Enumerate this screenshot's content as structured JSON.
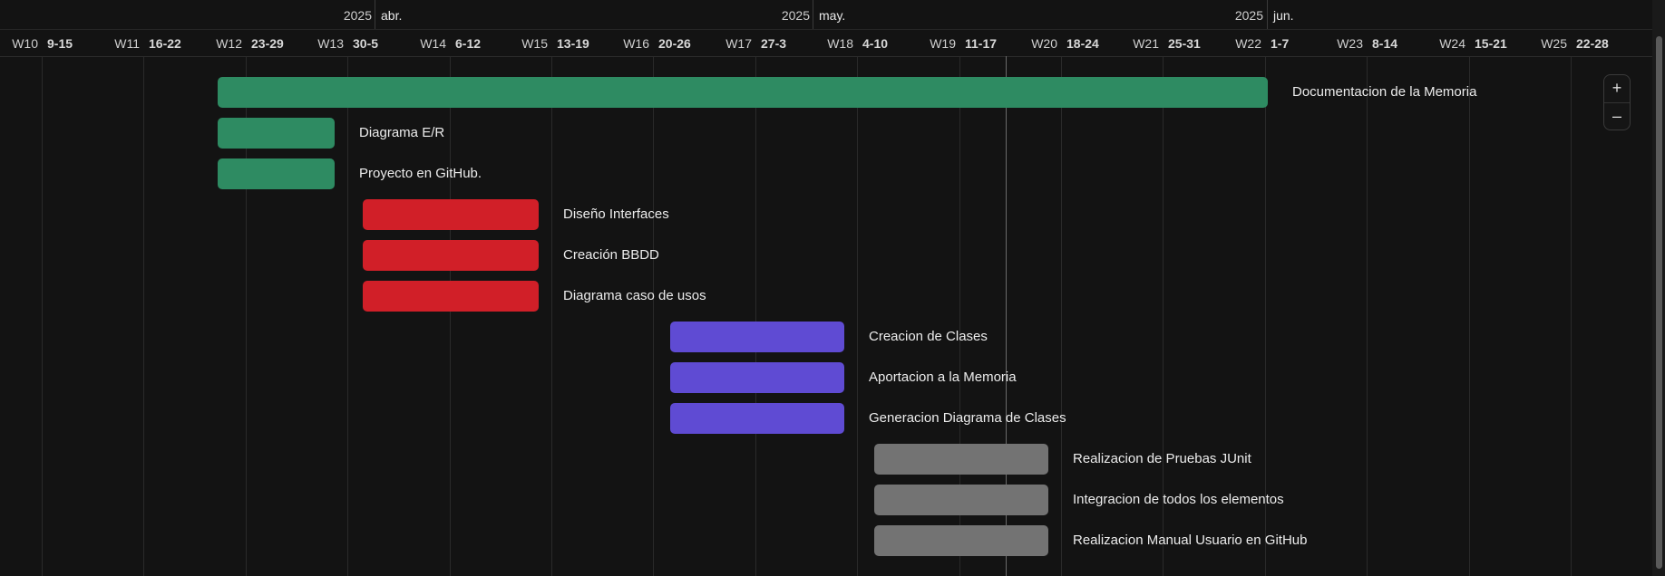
{
  "colors": {
    "background": "#131313",
    "green": "#2e8b62",
    "red": "#d11f28",
    "purple": "#5f4bd3",
    "gray": "#737373"
  },
  "timeline": {
    "months": [
      {
        "year": "2025",
        "label": "abr."
      },
      {
        "year": "2025",
        "label": "may."
      },
      {
        "year": "2025",
        "label": "jun."
      }
    ],
    "weeks": [
      {
        "num": "W10",
        "range": "9-15"
      },
      {
        "num": "W11",
        "range": "16-22"
      },
      {
        "num": "W12",
        "range": "23-29"
      },
      {
        "num": "W13",
        "range": "30-5"
      },
      {
        "num": "W14",
        "range": "6-12"
      },
      {
        "num": "W15",
        "range": "13-19"
      },
      {
        "num": "W16",
        "range": "20-26"
      },
      {
        "num": "W17",
        "range": "27-3"
      },
      {
        "num": "W18",
        "range": "4-10"
      },
      {
        "num": "W19",
        "range": "11-17"
      },
      {
        "num": "W20",
        "range": "18-24"
      },
      {
        "num": "W21",
        "range": "25-31"
      },
      {
        "num": "W22",
        "range": "1-7"
      },
      {
        "num": "W23",
        "range": "8-14"
      },
      {
        "num": "W24",
        "range": "15-21"
      },
      {
        "num": "W25",
        "range": "22-28"
      }
    ]
  },
  "tasks": [
    {
      "name": "Documentacion de la Memoria",
      "color": "green"
    },
    {
      "name": "Diagrama E/R",
      "color": "green"
    },
    {
      "name": "Proyecto en GitHub.",
      "color": "green"
    },
    {
      "name": "Diseño Interfaces",
      "color": "red"
    },
    {
      "name": "Creación BBDD",
      "color": "red"
    },
    {
      "name": "Diagrama caso de usos",
      "color": "red"
    },
    {
      "name": "Creacion de Clases",
      "color": "purple"
    },
    {
      "name": "Aportacion a la Memoria",
      "color": "purple"
    },
    {
      "name": "Generacion Diagrama de Clases",
      "color": "purple"
    },
    {
      "name": "Realizacion de Pruebas JUnit",
      "color": "gray"
    },
    {
      "name": "Integracion de todos los elementos",
      "color": "gray"
    },
    {
      "name": "Realizacion Manual Usuario en GitHub",
      "color": "gray"
    }
  ],
  "zoom": {
    "in_label": "+",
    "out_label": "–"
  }
}
